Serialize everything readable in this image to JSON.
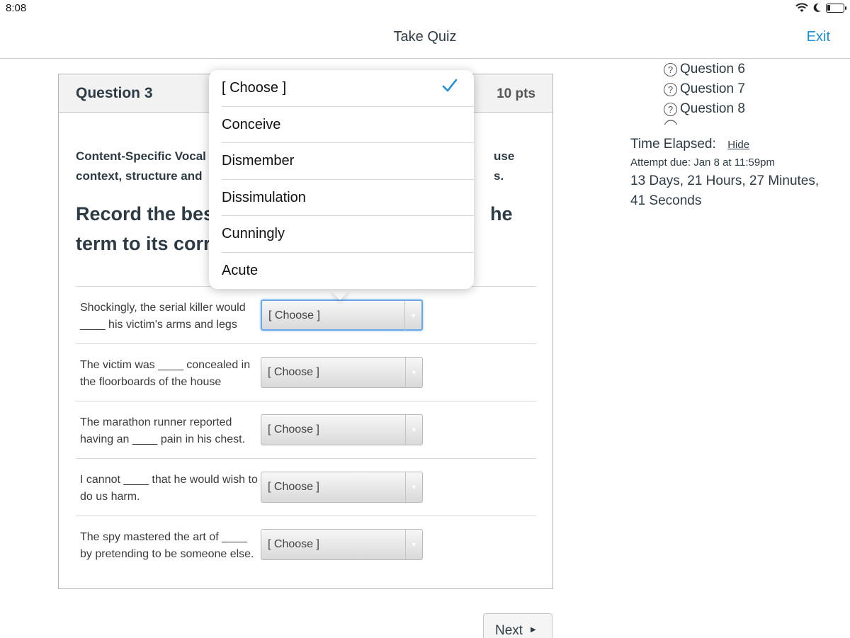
{
  "status": {
    "time": "8:08"
  },
  "nav": {
    "title": "Take Quiz",
    "exit": "Exit"
  },
  "question": {
    "title": "Question 3",
    "points": "10 pts",
    "instructions_left": [
      "Content-Specific Vocal",
      "context, structure and"
    ],
    "instructions_right": [
      "use",
      "s."
    ],
    "record_left": [
      "Record the bes",
      "term to its corr"
    ],
    "record_right": [
      "he"
    ],
    "rows": [
      {
        "text": "Shockingly, the serial killer would ____ his victim's arms and legs",
        "selected": "[ Choose ]"
      },
      {
        "text": "The victim was ____ concealed in the floorboards of the house",
        "selected": "[ Choose ]"
      },
      {
        "text": "The marathon runner reported having an ____ pain in his chest.",
        "selected": "[ Choose ]"
      },
      {
        "text": "I cannot ____ that he would wish to do us harm.",
        "selected": "[ Choose ]"
      },
      {
        "text": "The spy mastered the art of ____ by pretending to be someone else.",
        "selected": "[ Choose ]"
      }
    ]
  },
  "dropdown": {
    "options": [
      "[ Choose ]",
      "Conceive",
      "Dismember",
      "Dissimulation",
      "Cunningly",
      "Acute"
    ],
    "selected_index": 0,
    "check_color": "#1a8fd7"
  },
  "sidebar": {
    "questions": [
      "Question 6",
      "Question 7",
      "Question 8"
    ],
    "time_elapsed_label": "Time Elapsed:",
    "hide_label": "Hide",
    "attempt_due": "Attempt due: Jan 8 at 11:59pm",
    "elapsed_value": "13 Days, 21 Hours, 27 Minutes, 41 Seconds"
  },
  "footer": {
    "next_label": "Next"
  },
  "colors": {
    "accent": "#1a8fd7",
    "text": "#2d3b45"
  }
}
